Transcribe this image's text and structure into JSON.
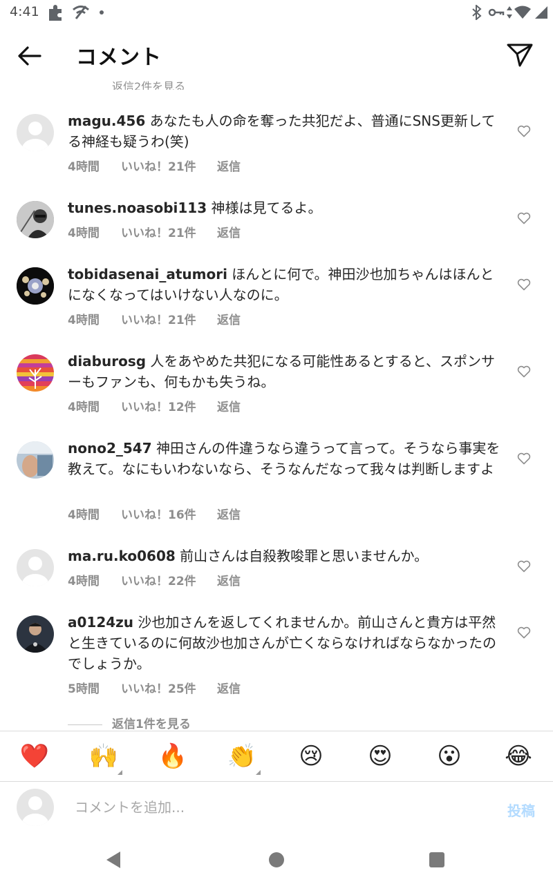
{
  "status_bar": {
    "time": "4:41"
  },
  "header": {
    "title": "コメント"
  },
  "partial_text": "返信2件を見る",
  "comments": [
    {
      "username": "magu.456",
      "text": "あなたも人の命を奪った共犯だよ、普通にSNS更新してる神経も疑うわ(笑)",
      "time": "4時間",
      "likes": "いいね！21件",
      "reply": "返信"
    },
    {
      "username": "tunes.noasobi113",
      "text": "神様は見てるよ。",
      "time": "4時間",
      "likes": "いいね！21件",
      "reply": "返信"
    },
    {
      "username": "tobidasenai_atumori",
      "text": "ほんとに何で。神田沙也加ちゃんはほんとになくなってはいけない人なのに。",
      "time": "4時間",
      "likes": "いいね！21件",
      "reply": "返信"
    },
    {
      "username": "diaburosg",
      "text": "人をあやめた共犯になる可能性あるとすると、スポンサーもファンも、何もかも失うね。",
      "time": "4時間",
      "likes": "いいね！12件",
      "reply": "返信"
    },
    {
      "username": "nono2_547",
      "text": "神田さんの件違うなら違うって言って。そうなら事実を教えて。なにもいわないなら、そうなんだなって我々は判断しますよ",
      "time": "4時間",
      "likes": "いいね！16件",
      "reply": "返信"
    },
    {
      "username": "ma.ru.ko0608",
      "text": "前山さんは自殺教唆罪と思いませんか。",
      "time": "4時間",
      "likes": "いいね！22件",
      "reply": "返信"
    },
    {
      "username": "a0124zu",
      "text": "沙也加さんを返してくれませんか。前山さんと貴方は平然と生きているのに何故沙也加さんが亡くならなければならなかったのでしょうか。",
      "time": "5時間",
      "likes": "いいね！25件",
      "reply": "返信"
    }
  ],
  "view_replies": "返信1件を見る",
  "emoji_bar": [
    "❤️",
    "🙌",
    "🔥",
    "👏",
    "😢",
    "😍",
    "😮",
    "😂"
  ],
  "input": {
    "placeholder": "コメントを追加...",
    "post_label": "投稿"
  },
  "colors": {
    "accent_disabled": "#b3dbff",
    "secondary_text": "#8e8e8e",
    "heart": "#e0245e"
  }
}
